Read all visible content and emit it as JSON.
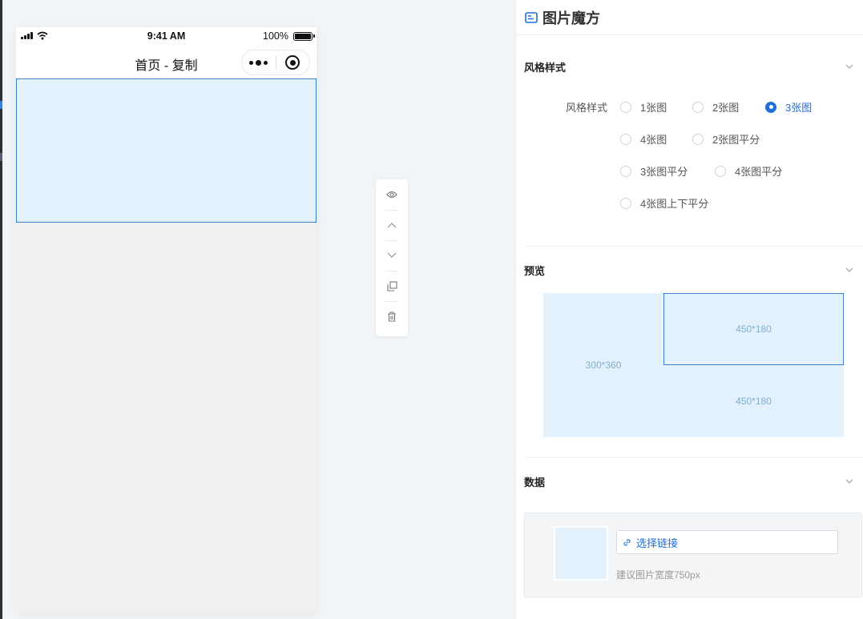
{
  "phone": {
    "status": {
      "time": "9:41 AM",
      "battery": "100%"
    },
    "nav_title": "首页 - 复制"
  },
  "toolbar": {
    "tools": [
      "eye-icon",
      "chevron-up-icon",
      "chevron-down-icon",
      "copy-icon",
      "trash-icon"
    ]
  },
  "panel": {
    "title": "图片魔方",
    "style_section": {
      "title": "风格样式",
      "label": "风格样式",
      "options": [
        "1张图",
        "2张图",
        "3张图",
        "4张图",
        "2张图平分",
        "3张图平分",
        "4张图平分",
        "4张图上下平分"
      ],
      "selected": "3张图"
    },
    "preview_section": {
      "title": "预览",
      "cells": [
        "300*360",
        "450*180",
        "450*180"
      ]
    },
    "data_section": {
      "title": "数据",
      "link_button": "选择链接",
      "hint": "建议图片宽度750px"
    }
  },
  "colors": {
    "accent": "#1e6fd9",
    "block_fill": "#e3f1fc",
    "block_border": "#3b7fd0",
    "preview_text": "#7fb0ce"
  }
}
